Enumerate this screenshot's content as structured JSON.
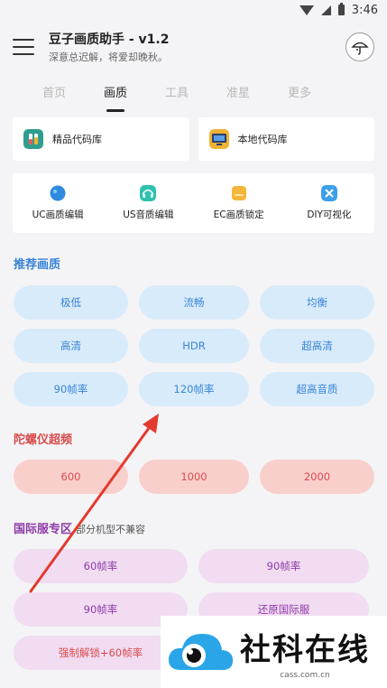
{
  "status": {
    "time": "3:46"
  },
  "app": {
    "title": "豆子画质助手 - v1.2",
    "subtitle": "深意总迟解，将爱却晚秋。"
  },
  "tabs": [
    "首页",
    "画质",
    "工具",
    "准星",
    "更多"
  ],
  "code_libs": {
    "premium": "精品代码库",
    "local": "本地代码库"
  },
  "tools": {
    "uc": "UC画质编辑",
    "us": "US音质编辑",
    "ec": "EC画质锁定",
    "diy": "DIY可视化"
  },
  "recommended": {
    "title": "推荐画质",
    "options": [
      "极低",
      "流畅",
      "均衡",
      "高清",
      "HDR",
      "超高清",
      "90帧率",
      "120帧率",
      "超高音质"
    ]
  },
  "gyro": {
    "title": "陀螺仪超频",
    "options": [
      "600",
      "1000",
      "2000"
    ]
  },
  "intl": {
    "title": "国际服专区",
    "note": "部分机型不兼容",
    "options": [
      "60帧率",
      "90帧率",
      "90帧率",
      "还原国际服",
      "强制解锁+60帧率"
    ]
  },
  "watermark": {
    "name": "社科在线",
    "url": "cass.com.cn"
  },
  "colors": {
    "blue": "#3a84d6",
    "red": "#d84c4c",
    "purple": "#8e3aa8",
    "arrow": "#e23a2e"
  }
}
